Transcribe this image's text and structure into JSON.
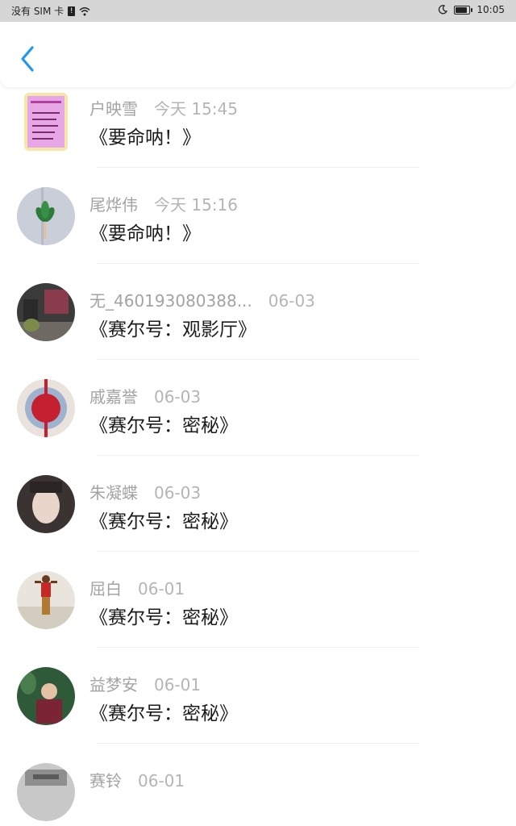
{
  "status_bar": {
    "carrier": "没有 SIM 卡",
    "sim_badge": "!",
    "time": "10:05",
    "battery_level": 0.75
  },
  "header": {
    "back_icon": "chevron-left-icon",
    "accent": "#2196f3"
  },
  "comments": [
    {
      "name": "",
      "time": "",
      "text": "《要命呐！》",
      "avatar": "pink-flower"
    },
    {
      "name": "户映雪",
      "time": "今天 15:45",
      "text": "《要命呐！》",
      "avatar": "pink-poster"
    },
    {
      "name": "尾烨伟",
      "time": "今天 15:16",
      "text": "《要命呐！》",
      "avatar": "leaf-hand"
    },
    {
      "name": "无_460193080388...",
      "time": "06-03",
      "text": "《赛尔号：观影厅》",
      "avatar": "street"
    },
    {
      "name": "戚嘉誉",
      "time": "06-03",
      "text": "《赛尔号：密秘》",
      "avatar": "red-knot"
    },
    {
      "name": "朱凝蝶",
      "time": "06-03",
      "text": "《赛尔号：密秘》",
      "avatar": "girl-portrait"
    },
    {
      "name": "屈白",
      "time": "06-01",
      "text": "《赛尔号：密秘》",
      "avatar": "figure-field"
    },
    {
      "name": "益梦安",
      "time": "06-01",
      "text": "《赛尔号：密秘》",
      "avatar": "girl-garden"
    },
    {
      "name": "赛铃",
      "time": "06-01",
      "text": "",
      "avatar": "bw-photo"
    }
  ]
}
